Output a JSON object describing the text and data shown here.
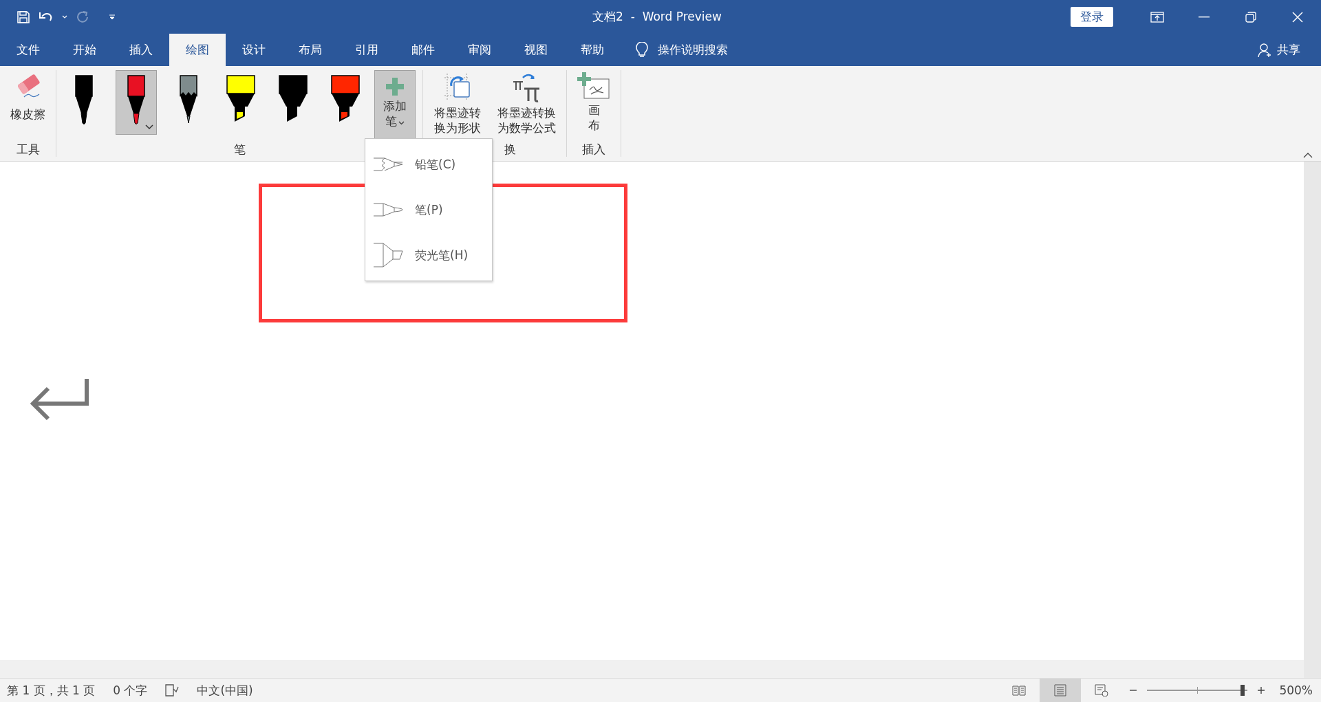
{
  "title_bar": {
    "title": "文档2  -  Word Preview",
    "sign_in": "登录",
    "redo_disabled": true
  },
  "tabs": [
    {
      "label": "文件",
      "selected": false
    },
    {
      "label": "开始",
      "selected": false
    },
    {
      "label": "插入",
      "selected": false
    },
    {
      "label": "绘图",
      "selected": true
    },
    {
      "label": "设计",
      "selected": false
    },
    {
      "label": "布局",
      "selected": false
    },
    {
      "label": "引用",
      "selected": false
    },
    {
      "label": "邮件",
      "selected": false
    },
    {
      "label": "审阅",
      "selected": false
    },
    {
      "label": "视图",
      "selected": false
    },
    {
      "label": "帮助",
      "selected": false
    }
  ],
  "tell_me": "操作说明搜索",
  "share": "共享",
  "ribbon": {
    "groups": [
      {
        "label": "工具",
        "items": [
          {
            "kind": "eraser",
            "label": "橡皮擦"
          }
        ]
      },
      {
        "label": "笔",
        "items": [
          {
            "kind": "pen",
            "color": "#000000",
            "selected": false
          },
          {
            "kind": "pen",
            "color": "#e81123",
            "selected": true
          },
          {
            "kind": "pencil",
            "color": "#7f8c8d",
            "selected": false
          },
          {
            "kind": "highlighter",
            "color": "#ffff00",
            "selected": false
          },
          {
            "kind": "highlighter",
            "color": "#000000",
            "selected": false
          },
          {
            "kind": "highlighter",
            "color": "#ff2600",
            "selected": false
          },
          {
            "kind": "add",
            "label": "添加笔",
            "expanded": true
          }
        ]
      },
      {
        "label": "换",
        "items": [
          {
            "kind": "shape",
            "label": "将墨迹转换为形状"
          },
          {
            "kind": "math",
            "label": "将墨迹转换为数学公式"
          }
        ]
      },
      {
        "label": "插入",
        "items": [
          {
            "kind": "canvas",
            "label": "画布"
          }
        ]
      }
    ]
  },
  "add_pen_menu": [
    {
      "kind": "pencil",
      "label": "铅笔(C)"
    },
    {
      "kind": "pen",
      "label": "笔(P)"
    },
    {
      "kind": "highlighter",
      "label": "荧光笔(H)"
    }
  ],
  "status_bar": {
    "page": "第 1 页，共 1 页",
    "words": "0 个字",
    "language": "中文(中国)",
    "views": [
      {
        "kind": "read",
        "selected": false
      },
      {
        "kind": "print",
        "selected": true
      },
      {
        "kind": "web",
        "selected": false
      }
    ],
    "zoom": {
      "level": 0.95,
      "reading": "500%"
    }
  }
}
